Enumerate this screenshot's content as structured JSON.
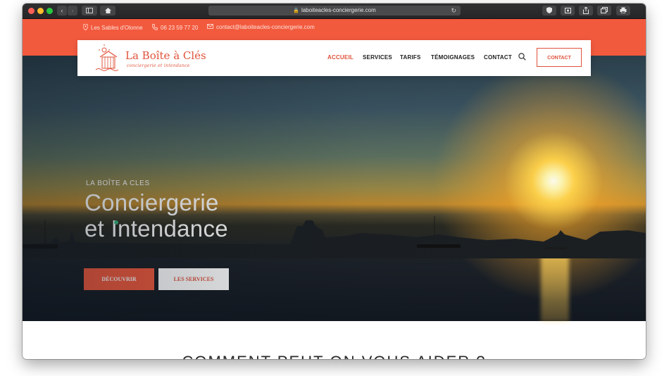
{
  "browser": {
    "url": "laboiteacles-conciergerie.com"
  },
  "topbar": {
    "location": "Les Sables d'Olonne",
    "phone": "06 23 59 77 20",
    "email": "contact@laboiteacles-conciergerie.com"
  },
  "logo": {
    "name": "La Boîte à Clés",
    "tagline": "conciergerie et intendance"
  },
  "nav": {
    "items": [
      "ACCUEIL",
      "SERVICES",
      "TARIFS",
      "TÉMOIGNAGES",
      "CONTACT"
    ],
    "active": "ACCUEIL",
    "contact_button": "CONTACT"
  },
  "hero": {
    "eyebrow": "LA BOÎTE A CLES",
    "title_line1": "Conciergerie",
    "title_line2": "et Intendance",
    "primary_button": "DÉCOUVRIR",
    "secondary_button": "LES SERVICES"
  },
  "section": {
    "heading": "COMMENT PEUT-ON VOUS AIDER ?"
  },
  "colors": {
    "brand": "#f25a3e",
    "brand_dark": "#e0523a",
    "text": "#1d1d1d"
  }
}
